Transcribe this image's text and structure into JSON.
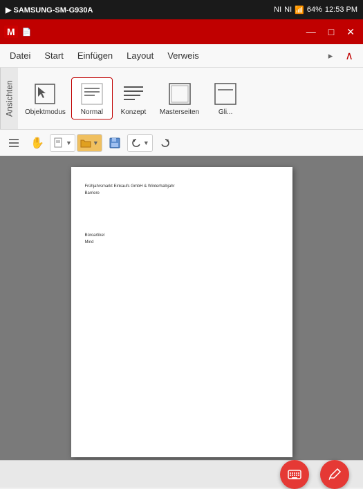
{
  "statusBar": {
    "appName": "SAMSUNG-SM-G930A",
    "leftIcons": [
      "gmail-icon",
      "notification-icon"
    ],
    "rightIcons": [
      "nfc-icon",
      "mute-icon",
      "signal-icon",
      "battery-icon"
    ],
    "batteryPercent": "64%",
    "time": "12:53 PM"
  },
  "appBar": {
    "leftIcons": [
      "gmail-m-icon",
      "doc-icon"
    ],
    "rightIcons": [
      "minimize-icon",
      "maximize-icon",
      "close-icon"
    ]
  },
  "menuBar": {
    "items": [
      "Datei",
      "Start",
      "Einfügen",
      "Layout",
      "Verweis"
    ],
    "overflow": "▸",
    "closeLabel": "∧"
  },
  "ribbon": {
    "tabLabel": "Ansichten",
    "items": [
      {
        "id": "objektmodus",
        "label": "Objektmodus",
        "active": false
      },
      {
        "id": "normal",
        "label": "Normal",
        "active": true
      },
      {
        "id": "konzept",
        "label": "Konzept",
        "active": false
      },
      {
        "id": "masterseiten",
        "label": "Masterseiten",
        "active": false
      },
      {
        "id": "gliederung",
        "label": "Gli...",
        "active": false
      }
    ]
  },
  "toolbar2": {
    "buttons": [
      {
        "id": "menu-btn",
        "icon": "≡"
      },
      {
        "id": "hand-btn",
        "icon": "✋"
      },
      {
        "id": "page-btn",
        "icon": "📄"
      },
      {
        "id": "folder-btn",
        "icon": "📁"
      },
      {
        "id": "save-btn",
        "icon": "💾"
      },
      {
        "id": "undo-btn",
        "icon": "↺"
      },
      {
        "id": "redo-btn",
        "icon": "↻"
      }
    ]
  },
  "document": {
    "page": {
      "textLine1": "Frühjahrsmarkt Einkaufs GmbH & Winterhalbjahr",
      "textLine2": "Barriere",
      "textLine3": "",
      "section2Line1": "Büroartikel",
      "section2Line2": "Mind"
    }
  },
  "bottomBar": {
    "keyboardFabLabel": "⌨",
    "editFabLabel": "✏"
  }
}
